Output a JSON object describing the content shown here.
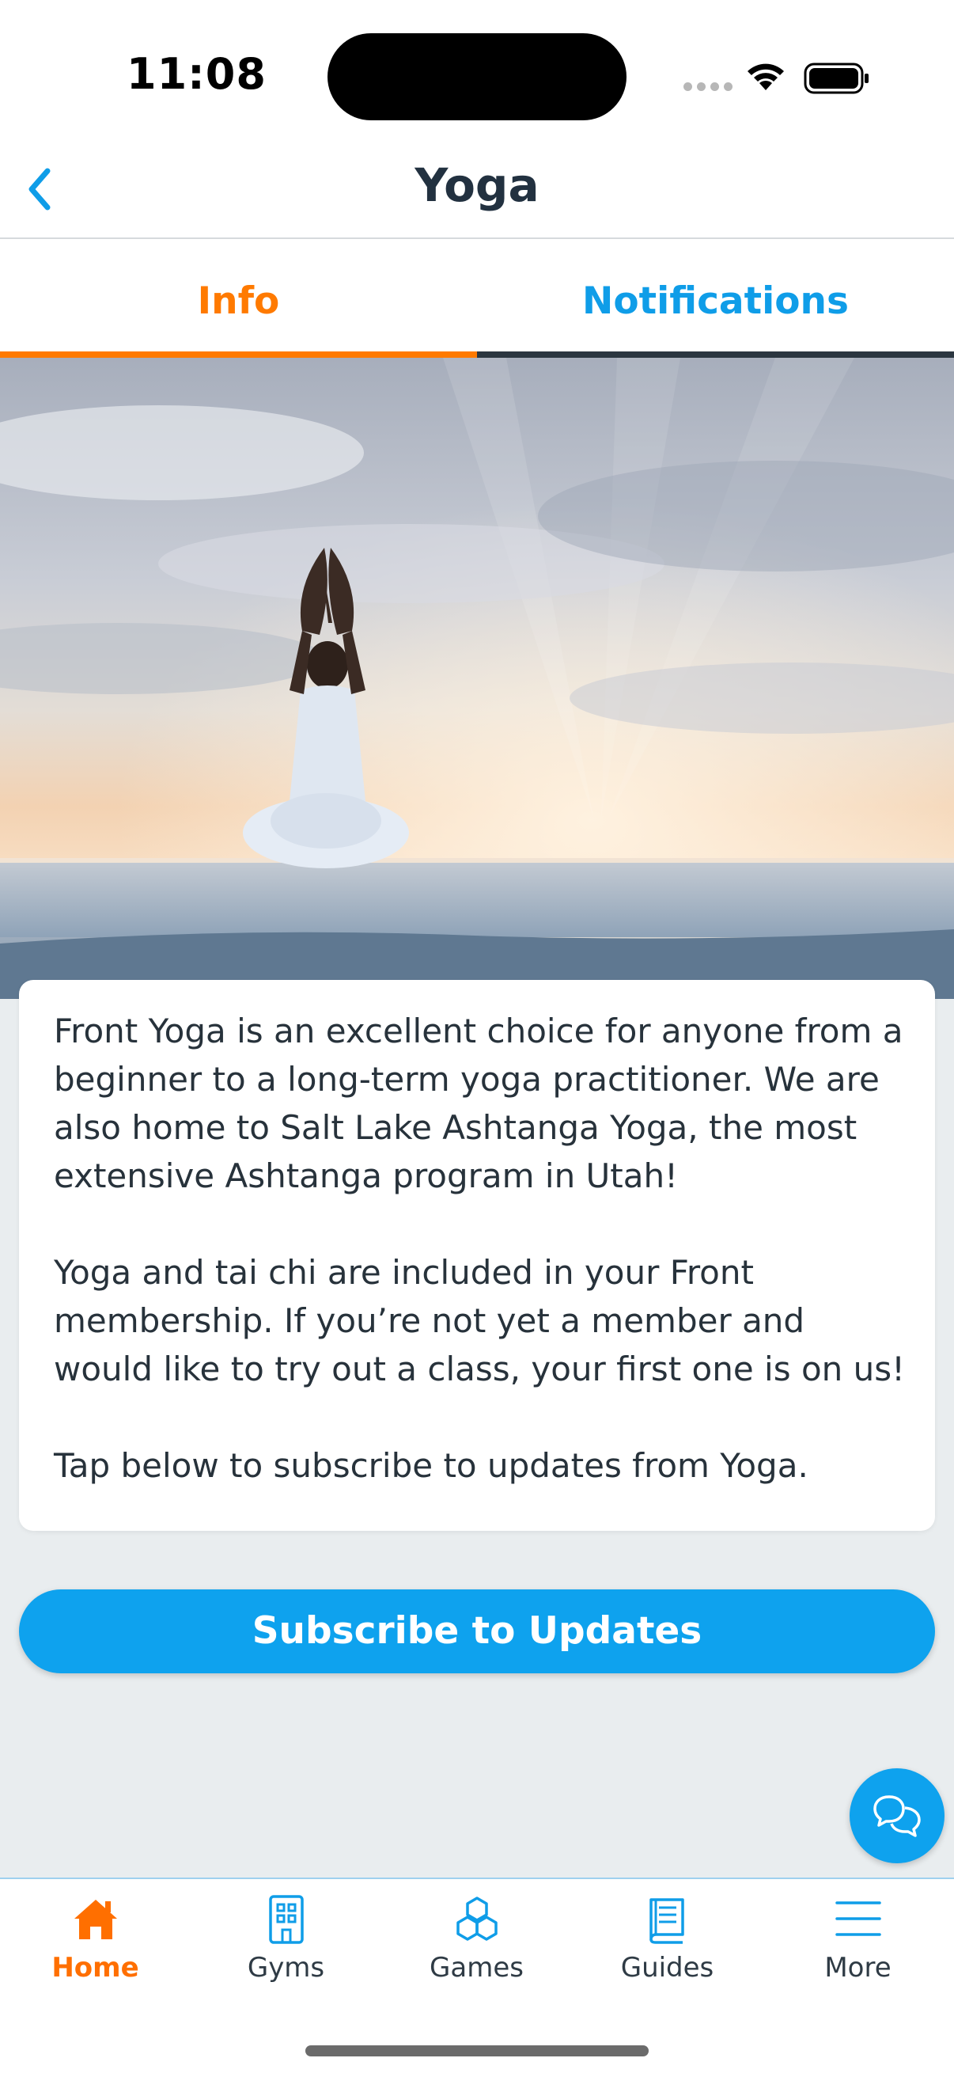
{
  "status_bar": {
    "time": "11:08",
    "icons": [
      "cellular-signal-icon",
      "wifi-icon",
      "battery-icon"
    ]
  },
  "nav": {
    "title": "Yoga",
    "back_icon": "chevron-left-icon"
  },
  "tabs": [
    {
      "label": "Info",
      "active": true
    },
    {
      "label": "Notifications",
      "active": false
    }
  ],
  "hero_image": {
    "subject": "person-meditating-on-beach-at-sunrise"
  },
  "description": {
    "paragraphs": [
      "Front Yoga is an excellent choice for anyone from a beginner to a long-term yoga practitioner. We are also home to Salt Lake Ashtanga Yoga, the most extensive Ashtanga program in Utah!",
      "Yoga and tai chi are included in your Front membership. If you’re not yet a member and would like to try out a class, your first one is on us!",
      "Tap below to subscribe to updates from Yoga."
    ]
  },
  "subscribe_button": {
    "label": "Subscribe to Updates"
  },
  "chat_button": {
    "icon": "chat-bubbles-icon"
  },
  "bottom_nav": {
    "items": [
      {
        "label": "Home",
        "icon": "home-icon",
        "active": true
      },
      {
        "label": "Gyms",
        "icon": "building-icon",
        "active": false
      },
      {
        "label": "Games",
        "icon": "hexagons-icon",
        "active": false
      },
      {
        "label": "Guides",
        "icon": "book-icon",
        "active": false
      },
      {
        "label": "More",
        "icon": "menu-icon",
        "active": false
      }
    ]
  },
  "colors": {
    "accent_orange": "#ff7a00",
    "accent_blue": "#0ea2ee",
    "background": "#e9edef",
    "text_dark": "#223140"
  }
}
